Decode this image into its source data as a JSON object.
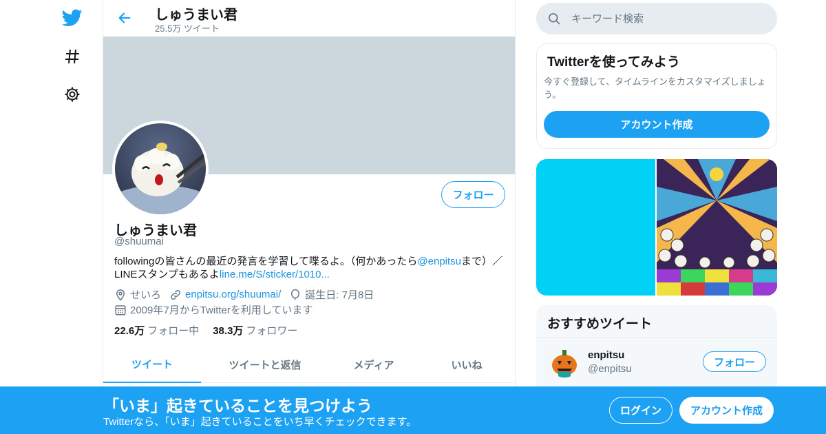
{
  "header": {
    "name": "しゅうまい君",
    "tweet_count": "25.5万 ツイート"
  },
  "profile": {
    "name": "しゅうまい君",
    "handle": "@shuumai",
    "follow_label": "フォロー",
    "bio_text_1": "followingの皆さんの最近の発言を学習して喋るよ。（何かあったら",
    "bio_mention": "@enpitsu",
    "bio_text_2": "まで）／LINEスタンプもあるよ",
    "bio_link": "line.me/S/sticker/1010...",
    "location": "せいろ",
    "website": "enpitsu.org/shuumai/",
    "birthday": "誕生日: 7月8日",
    "joined": "2009年7月からTwitterを利用しています",
    "following_count": "22.6万",
    "following_label": "フォロー中",
    "followers_count": "38.3万",
    "followers_label": "フォロワー"
  },
  "tabs": [
    {
      "label": "ツイート"
    },
    {
      "label": "ツイートと返信"
    },
    {
      "label": "メディア"
    },
    {
      "label": "いいね"
    }
  ],
  "search": {
    "placeholder": "キーワード検索"
  },
  "signup_box": {
    "title": "Twitterを使ってみよう",
    "description": "今すぐ登録して、タイムラインをカスタマイズしましょう。",
    "button": "アカウント作成"
  },
  "recommended": {
    "title": "おすすめツイート",
    "user_name": "enpitsu",
    "user_handle": "@enpitsu",
    "follow_label": "フォロー"
  },
  "bottom_bar": {
    "title": "「いま」起きていることを見つけよう",
    "subtitle": "Twitterなら、「いま」起きていることをいち早くチェックできます。",
    "login": "ログイン",
    "create": "アカウント作成"
  },
  "colors": {
    "accent": "#1da1f2",
    "banner": "#ccd6dd",
    "secondary_text": "#657786"
  },
  "icons": [
    "twitter-bird-icon",
    "hashtag-icon",
    "gear-icon",
    "back-arrow-icon",
    "search-icon",
    "location-icon",
    "link-icon",
    "balloon-icon",
    "calendar-icon"
  ]
}
